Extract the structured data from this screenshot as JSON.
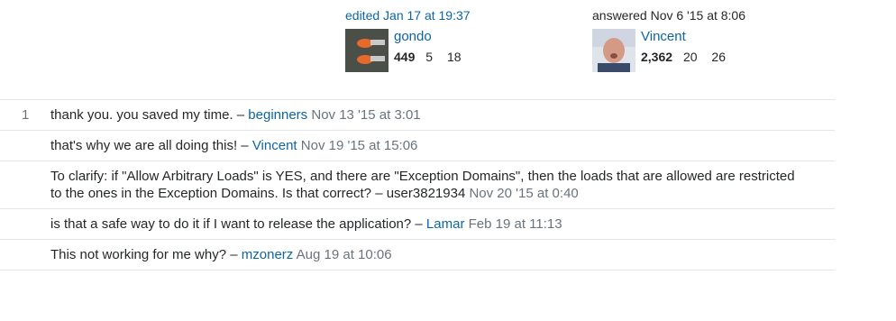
{
  "editor": {
    "action": "edited Jan 17 at 19:37",
    "user": "gondo",
    "reputation": "449",
    "silver": "5",
    "bronze": "18"
  },
  "answerer": {
    "action": "answered Nov 6 '15 at 8:06",
    "user": "Vincent",
    "reputation": "2,362",
    "silver": "20",
    "bronze": "26"
  },
  "comments": [
    {
      "score": "1",
      "text": "thank you. you saved my time.",
      "sep": " – ",
      "user": "beginners",
      "date": "Nov 13 '15 at 3:01"
    },
    {
      "score": "",
      "text": "that's why we are all doing this!",
      "sep": " – ",
      "user": "Vincent",
      "date": "Nov 19 '15 at 15:06"
    },
    {
      "score": "",
      "text": "To clarify: if \"Allow Arbitrary Loads\" is YES, and there are \"Exception Domains\", then the loads that are allowed are restricted to the ones in the Exception Domains. Is that correct?",
      "sep": " – ",
      "user": "user3821934",
      "date": "Nov 20 '15 at 0:40"
    },
    {
      "score": "",
      "text": "is that a safe way to do it if I want to release the application?",
      "sep": " – ",
      "user": "Lamar",
      "date": "Feb 19 at 11:13"
    },
    {
      "score": "",
      "text": "This not working for me why?",
      "sep": " – ",
      "user": "mzonerz",
      "date": "Aug 19 at 10:06"
    }
  ]
}
